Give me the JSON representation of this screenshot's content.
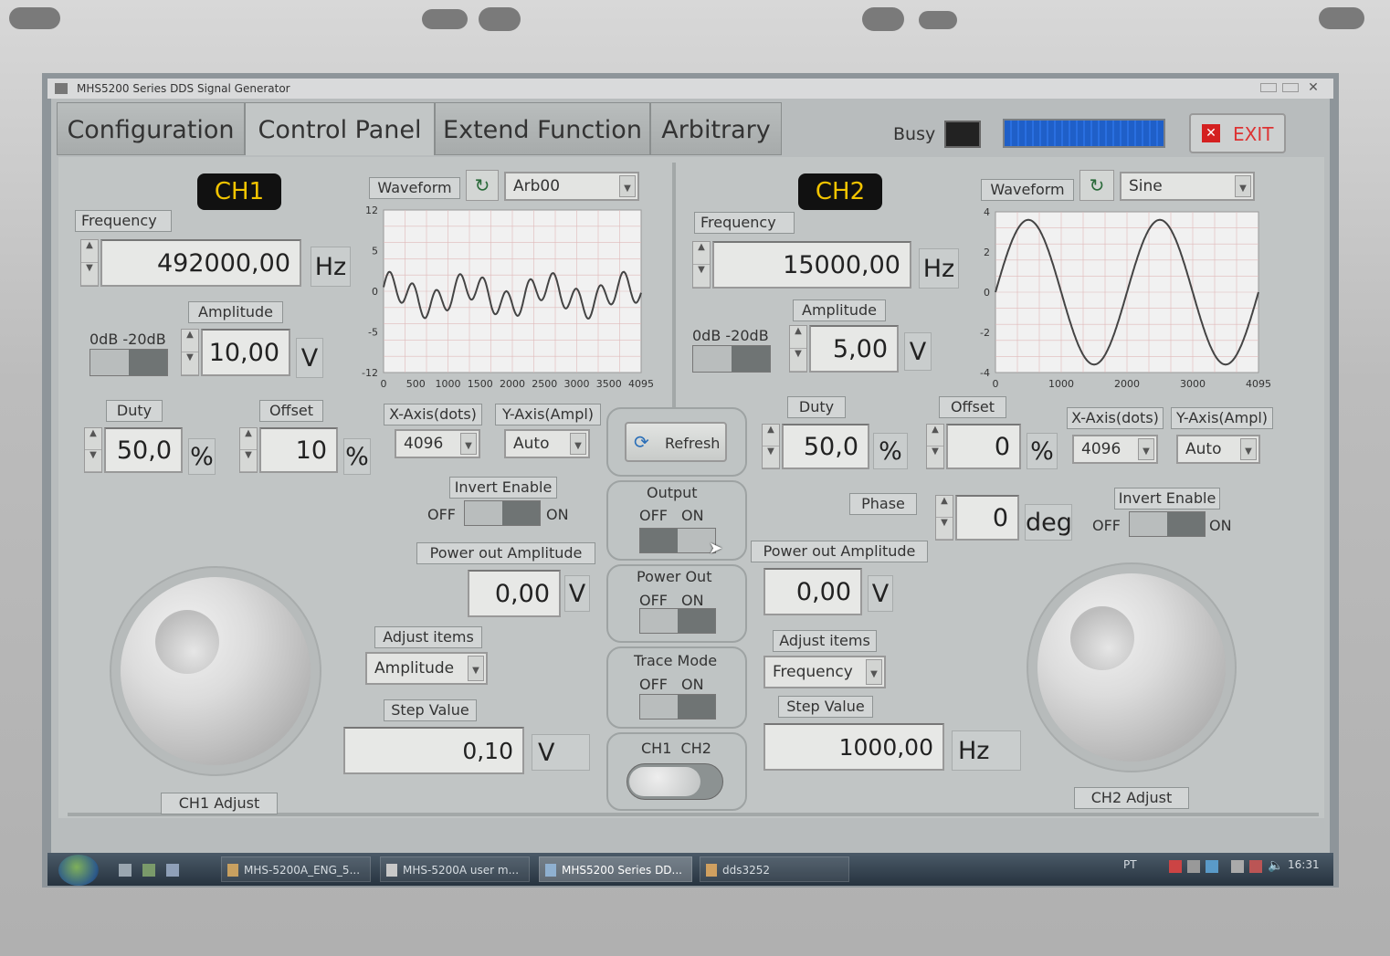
{
  "window": {
    "title": "MHS5200 Series DDS Signal Generator"
  },
  "tabs": [
    "Configuration",
    "Control Panel",
    "Extend Function",
    "Arbitrary"
  ],
  "busy_label": "Busy",
  "exit_label": "EXIT",
  "ch1": {
    "badge": "CH1",
    "frequency_label": "Frequency",
    "frequency_value": "492000,00",
    "frequency_unit": "Hz",
    "amplitude_label": "Amplitude",
    "amplitude_value": "10,00",
    "amplitude_unit": "V",
    "atten_label": "0dB -20dB",
    "duty_label": "Duty",
    "duty_value": "50,0",
    "duty_unit": "%",
    "offset_label": "Offset",
    "offset_value": "10",
    "offset_unit": "%",
    "waveform_label": "Waveform",
    "waveform_value": "Arb00",
    "xaxis_label": "X-Axis(dots)",
    "xaxis_value": "4096",
    "yaxis_label": "Y-Axis(Ampl)",
    "yaxis_value": "Auto",
    "invert_label": "Invert Enable",
    "off": "OFF",
    "on": "ON",
    "power_out_amp_label": "Power out Amplitude",
    "power_out_amp_value": "0,00",
    "power_out_amp_unit": "V",
    "adjust_items_label": "Adjust items",
    "adjust_items_value": "Amplitude",
    "step_label": "Step Value",
    "step_value": "0,10",
    "step_unit": "V",
    "adjust_knob_label": "CH1 Adjust",
    "graph": {
      "yticks": [
        "12",
        "5",
        "0",
        "-5",
        "-12"
      ],
      "xticks": [
        "0",
        "500",
        "1000",
        "1500",
        "2000",
        "2500",
        "3000",
        "3500",
        "4095"
      ]
    }
  },
  "ch2": {
    "badge": "CH2",
    "frequency_label": "Frequency",
    "frequency_value": "15000,00",
    "frequency_unit": "Hz",
    "amplitude_label": "Amplitude",
    "amplitude_value": "5,00",
    "amplitude_unit": "V",
    "atten_label": "0dB -20dB",
    "duty_label": "Duty",
    "duty_value": "50,0",
    "duty_unit": "%",
    "offset_label": "Offset",
    "offset_value": "0",
    "offset_unit": "%",
    "waveform_label": "Waveform",
    "waveform_value": "Sine",
    "xaxis_label": "X-Axis(dots)",
    "xaxis_value": "4096",
    "yaxis_label": "Y-Axis(Ampl)",
    "yaxis_value": "Auto",
    "phase_label": "Phase",
    "phase_value": "0",
    "phase_unit": "deg",
    "invert_label": "Invert Enable",
    "off": "OFF",
    "on": "ON",
    "power_out_amp_label": "Power out Amplitude",
    "power_out_amp_value": "0,00",
    "power_out_amp_unit": "V",
    "adjust_items_label": "Adjust items",
    "adjust_items_value": "Frequency",
    "step_label": "Step Value",
    "step_value": "1000,00",
    "step_unit": "Hz",
    "adjust_knob_label": "CH2 Adjust",
    "graph": {
      "yticks": [
        "4",
        "2",
        "0",
        "-2",
        "-4"
      ],
      "xticks": [
        "0",
        "1000",
        "2000",
        "3000",
        "4095"
      ]
    }
  },
  "center": {
    "refresh_label": "Refresh",
    "output_label": "Output",
    "power_out_label": "Power Out",
    "trace_mode_label": "Trace Mode",
    "off": "OFF",
    "on": "ON",
    "ch_switch_label": "CH1  CH2"
  },
  "taskbar": {
    "items": [
      "MHS-5200A_ENG_5...",
      "MHS-5200A user m...",
      "MHS5200 Series DD...",
      "dds3252"
    ],
    "lang": "PT",
    "time": "16:31"
  },
  "colors": {
    "busy_bar": "#1f5fc8",
    "badge_text": "#f2c400",
    "exit_icon": "#d42020"
  }
}
